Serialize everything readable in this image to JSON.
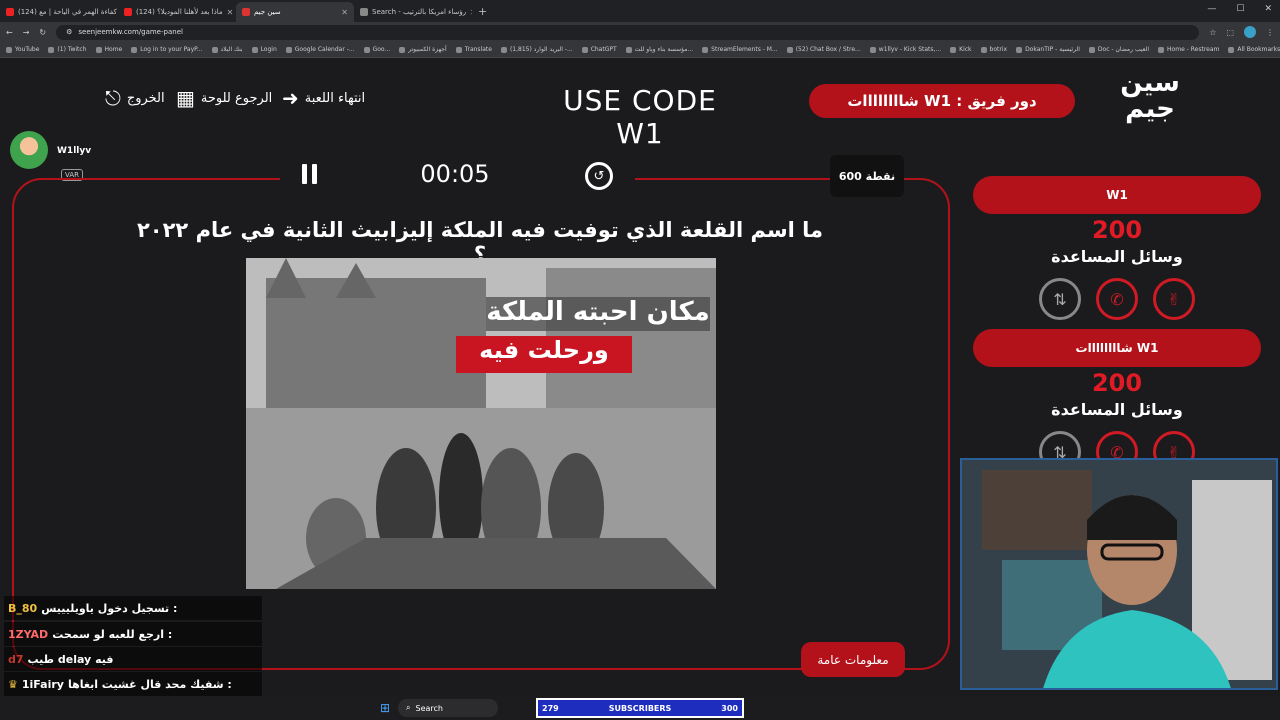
{
  "browser": {
    "tabs": [
      {
        "label": "(124) كفاءة الهمر في الياحة | مع",
        "color": "#e22"
      },
      {
        "label": "(124) ماذا بعد لأهلنا الموديلا؟",
        "color": "#e22"
      },
      {
        "label": "سين جيم",
        "color": "#d33"
      },
      {
        "label": "Search - رؤساء امريكا بالترتيب",
        "color": "#888"
      }
    ],
    "active_tab": 2,
    "new_tab": "+",
    "url": "seenjeemkw.com/game-panel",
    "bookmarks": [
      "YouTube",
      "(1) Twitch",
      "Home",
      "Log in to your PayP...",
      "بنك البلاد",
      "Login",
      "Google Calendar -...",
      "Goo...",
      "أجهزة الكمبيوتر",
      "Translate",
      "(1,815) البريد الوارد -...",
      "ChatGPT",
      "مؤسسة بناء وياو للت...",
      "StreamElements - M...",
      "(52) Chat Box / Stre...",
      "w1llyv - Kick Stats,...",
      "Kick",
      "botrix",
      "DokanTIP - الرئيسية",
      "Doc - العيب رمضان",
      "Home - Restream",
      "All Bookmarks"
    ],
    "win_controls": [
      "—",
      "☐",
      "✕"
    ]
  },
  "header": {
    "exit": "الخروج",
    "back_to_board": "الرجوع للوحة",
    "end_game": "انتهاء اللعبة",
    "use_code": "USE CODE W1",
    "team_turn": "دور فريق : W1 شاااااااات",
    "logo_line1": "سين",
    "logo_line2": "جيم"
  },
  "board": {
    "timer": "00:05",
    "points": "600 نقطة",
    "player_name": "W1llyv",
    "var_badge": "VAR",
    "question": "ما اسم القلعة الذي توفيت فيه الملكة إليزابيث الثانية في عام ٢٠٢٢ ؟",
    "caption_line1": "مكان احبته الملكة",
    "caption_line2": "ورحلت فيه",
    "info_button": "معلومات عامة"
  },
  "teams": [
    {
      "name": "W1",
      "score": "200",
      "aids_label": "وسائل المساعدة"
    },
    {
      "name": "W1 شاااااااات",
      "score": "200",
      "aids_label": "وسائل المساعدة"
    }
  ],
  "chat": [
    {
      "user": "B_80",
      "text": "تسجيل دخول ياويليييس :",
      "color": "#f0c040"
    },
    {
      "user": "1ZYAD",
      "text": "ارجع للعبه لو سمحت :",
      "color": "#ff6b6b"
    },
    {
      "user": "d7",
      "text": "طيب delay فيه",
      "color": "#c0392b"
    },
    {
      "user": "1iFairy",
      "text": "شفيك محد قال غشيت ابغاها :",
      "color": "#fff"
    }
  ],
  "taskbar": {
    "search": "Search",
    "subs_current": "279",
    "subs_label": "SUBSCRIBERS",
    "subs_goal": "300"
  }
}
